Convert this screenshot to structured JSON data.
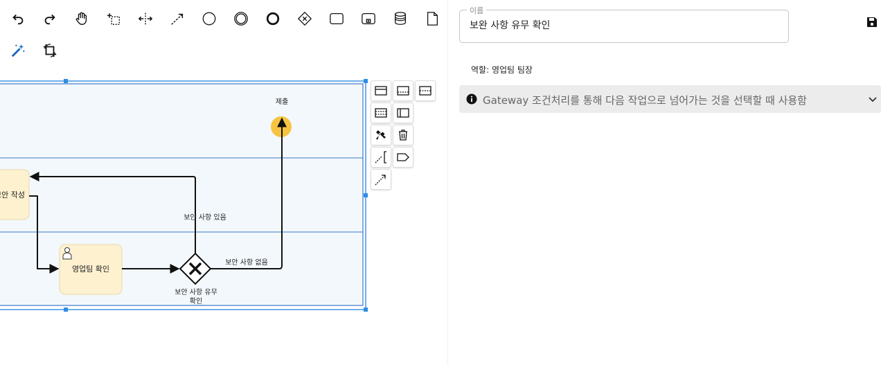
{
  "toolbar": {
    "tools": [
      {
        "icon": "undo-icon"
      },
      {
        "icon": "redo-icon"
      },
      {
        "icon": "hand-tool-icon"
      },
      {
        "icon": "lasso-tool-icon"
      },
      {
        "icon": "space-tool-icon"
      },
      {
        "icon": "global-connect-icon"
      },
      {
        "icon": "start-event-icon"
      },
      {
        "icon": "intermediate-event-icon"
      },
      {
        "icon": "end-event-icon"
      },
      {
        "icon": "gateway-icon"
      },
      {
        "icon": "task-icon"
      },
      {
        "icon": "subprocess-icon"
      },
      {
        "icon": "data-store-icon"
      },
      {
        "icon": "data-object-icon"
      },
      {
        "icon": "magic-wand-icon"
      },
      {
        "icon": "crop-icon"
      }
    ]
  },
  "diagram": {
    "submit_label": "제출",
    "task_proposal_label": "보안 작성",
    "task_sales_label": "영업팀 확인",
    "flow_yes_label": "보안 사항 있음",
    "flow_no_label": "보안 사항 없음",
    "gateway_label_line1": "보안 사항 유무",
    "gateway_label_line2": "확인"
  },
  "properties": {
    "name_legend": "이름",
    "name_value": "보완 사항 유무 확인",
    "role_text": "역할: 영업팀 팀장",
    "info_text": "Gateway 조건처리를 통해 다음 작업으로 넘어가는 것을 선택할 때 사용함"
  },
  "colors": {
    "selection": "#2f8de4",
    "pool_fill": "#f3f8fc",
    "task_fill": "#fdf1d0",
    "end_event": "#f6c441",
    "info_bg": "#ececec"
  }
}
